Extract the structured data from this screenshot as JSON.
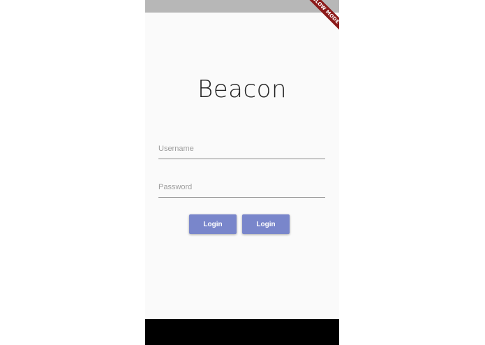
{
  "debug_banner": "SLOW MODE",
  "app": {
    "title": "Beacon"
  },
  "form": {
    "username": {
      "placeholder": "Username",
      "value": ""
    },
    "password": {
      "placeholder": "Password",
      "value": ""
    }
  },
  "buttons": [
    {
      "label": "Login"
    },
    {
      "label": "Login"
    }
  ],
  "colors": {
    "accent": "#7986cb",
    "background": "#fafafa",
    "status_bar": "#b7b7b7",
    "nav_bar": "#000000",
    "banner": "#8b1a1a"
  }
}
